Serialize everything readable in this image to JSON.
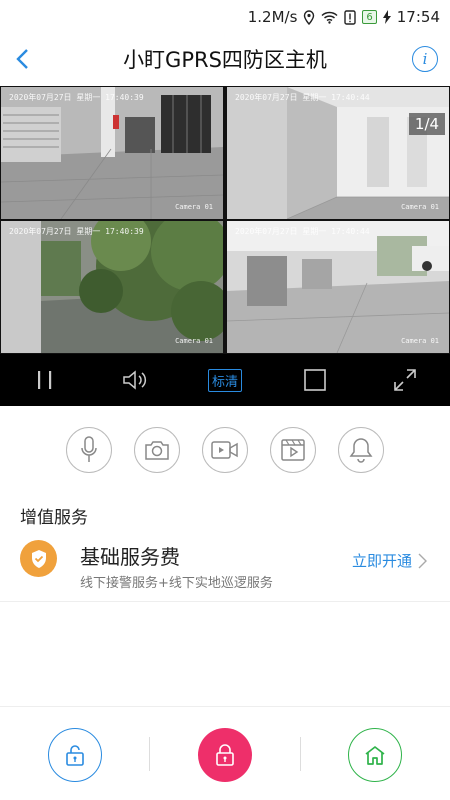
{
  "status_bar": {
    "speed": "1.2M/s",
    "battery": "6",
    "time": "17:54"
  },
  "header": {
    "title": "小盯GPRS四防区主机",
    "info_label": "i"
  },
  "video": {
    "page_indicator": "1/4",
    "cameras": [
      {
        "stamp": "2020年07月27日 星期一 17:40:39",
        "label": "Camera 01"
      },
      {
        "stamp": "2020年07月27日 星期一 17:40:44",
        "label": "Camera 01"
      },
      {
        "stamp": "2020年07月27日 星期一 17:40:39",
        "label": "Camera 01"
      },
      {
        "stamp": "2020年07月27日 星期一 17:40:44",
        "label": "Camera 01"
      }
    ]
  },
  "controls": {
    "quality_label": "标清"
  },
  "actions": [
    "mic-icon",
    "camera-icon",
    "video-record-icon",
    "playback-icon",
    "bell-icon"
  ],
  "service_section": {
    "title": "增值服务",
    "item": {
      "name": "基础服务费",
      "description": "线下接警服务+线下实地巡逻服务",
      "action": "立即开通"
    }
  },
  "colors": {
    "accent": "#2a8be0",
    "arm_pink": "#ee2f6a",
    "home_green": "#2fb34a",
    "badge_orange": "#f0a13c"
  }
}
